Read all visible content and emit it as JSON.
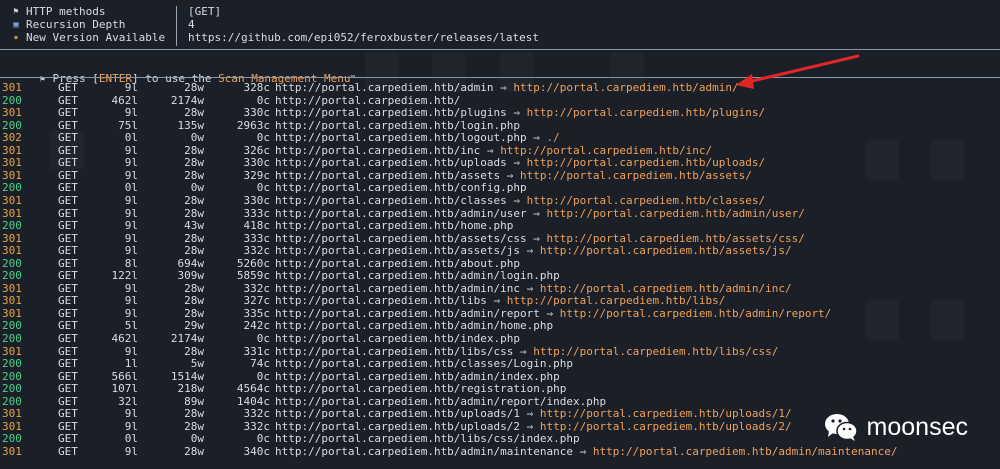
{
  "header": {
    "rows": [
      {
        "icon": "flag-icon",
        "glyph": "⚑",
        "key": "HTTP methods",
        "value": "[GET]"
      },
      {
        "icon": "disk-icon",
        "glyph": "▣",
        "key": "Recursion Depth",
        "value": "4"
      },
      {
        "icon": "party-icon",
        "glyph": "✷",
        "key": "New Version Available",
        "value": "https://github.com/epi052/feroxbuster/releases/latest"
      }
    ],
    "press_pre": "Press [",
    "press_key": "ENTER",
    "press_mid": "] to use the ",
    "press_menu": "Scan Management Menu",
    "press_tm": "™"
  },
  "colors": {
    "redirect": "#f0a15a",
    "ok": "#4cd18a",
    "arrow": "#e02626"
  },
  "results": [
    {
      "status": "301",
      "method": "GET",
      "lines": "9l",
      "words": "28w",
      "chars": "328c",
      "url": "http://portal.carpediem.htb/admin",
      "redirect": "http://portal.carpediem.htb/admin/"
    },
    {
      "status": "200",
      "method": "GET",
      "lines": "462l",
      "words": "2174w",
      "chars": "0c",
      "url": "http://portal.carpediem.htb/",
      "redirect": ""
    },
    {
      "status": "301",
      "method": "GET",
      "lines": "9l",
      "words": "28w",
      "chars": "330c",
      "url": "http://portal.carpediem.htb/plugins",
      "redirect": "http://portal.carpediem.htb/plugins/"
    },
    {
      "status": "200",
      "method": "GET",
      "lines": "75l",
      "words": "135w",
      "chars": "2963c",
      "url": "http://portal.carpediem.htb/login.php",
      "redirect": ""
    },
    {
      "status": "302",
      "method": "GET",
      "lines": "0l",
      "words": "0w",
      "chars": "0c",
      "url": "http://portal.carpediem.htb/logout.php",
      "redirect": "./"
    },
    {
      "status": "301",
      "method": "GET",
      "lines": "9l",
      "words": "28w",
      "chars": "326c",
      "url": "http://portal.carpediem.htb/inc",
      "redirect": "http://portal.carpediem.htb/inc/"
    },
    {
      "status": "301",
      "method": "GET",
      "lines": "9l",
      "words": "28w",
      "chars": "330c",
      "url": "http://portal.carpediem.htb/uploads",
      "redirect": "http://portal.carpediem.htb/uploads/"
    },
    {
      "status": "301",
      "method": "GET",
      "lines": "9l",
      "words": "28w",
      "chars": "329c",
      "url": "http://portal.carpediem.htb/assets",
      "redirect": "http://portal.carpediem.htb/assets/"
    },
    {
      "status": "200",
      "method": "GET",
      "lines": "0l",
      "words": "0w",
      "chars": "0c",
      "url": "http://portal.carpediem.htb/config.php",
      "redirect": ""
    },
    {
      "status": "301",
      "method": "GET",
      "lines": "9l",
      "words": "28w",
      "chars": "330c",
      "url": "http://portal.carpediem.htb/classes",
      "redirect": "http://portal.carpediem.htb/classes/"
    },
    {
      "status": "301",
      "method": "GET",
      "lines": "9l",
      "words": "28w",
      "chars": "333c",
      "url": "http://portal.carpediem.htb/admin/user",
      "redirect": "http://portal.carpediem.htb/admin/user/"
    },
    {
      "status": "200",
      "method": "GET",
      "lines": "9l",
      "words": "43w",
      "chars": "418c",
      "url": "http://portal.carpediem.htb/home.php",
      "redirect": ""
    },
    {
      "status": "301",
      "method": "GET",
      "lines": "9l",
      "words": "28w",
      "chars": "333c",
      "url": "http://portal.carpediem.htb/assets/css",
      "redirect": "http://portal.carpediem.htb/assets/css/"
    },
    {
      "status": "301",
      "method": "GET",
      "lines": "9l",
      "words": "28w",
      "chars": "332c",
      "url": "http://portal.carpediem.htb/assets/js",
      "redirect": "http://portal.carpediem.htb/assets/js/"
    },
    {
      "status": "200",
      "method": "GET",
      "lines": "8l",
      "words": "694w",
      "chars": "5260c",
      "url": "http://portal.carpediem.htb/about.php",
      "redirect": ""
    },
    {
      "status": "200",
      "method": "GET",
      "lines": "122l",
      "words": "309w",
      "chars": "5859c",
      "url": "http://portal.carpediem.htb/admin/login.php",
      "redirect": ""
    },
    {
      "status": "301",
      "method": "GET",
      "lines": "9l",
      "words": "28w",
      "chars": "332c",
      "url": "http://portal.carpediem.htb/admin/inc",
      "redirect": "http://portal.carpediem.htb/admin/inc/"
    },
    {
      "status": "301",
      "method": "GET",
      "lines": "9l",
      "words": "28w",
      "chars": "327c",
      "url": "http://portal.carpediem.htb/libs",
      "redirect": "http://portal.carpediem.htb/libs/"
    },
    {
      "status": "301",
      "method": "GET",
      "lines": "9l",
      "words": "28w",
      "chars": "335c",
      "url": "http://portal.carpediem.htb/admin/report",
      "redirect": "http://portal.carpediem.htb/admin/report/"
    },
    {
      "status": "200",
      "method": "GET",
      "lines": "5l",
      "words": "29w",
      "chars": "242c",
      "url": "http://portal.carpediem.htb/admin/home.php",
      "redirect": ""
    },
    {
      "status": "200",
      "method": "GET",
      "lines": "462l",
      "words": "2174w",
      "chars": "0c",
      "url": "http://portal.carpediem.htb/index.php",
      "redirect": ""
    },
    {
      "status": "301",
      "method": "GET",
      "lines": "9l",
      "words": "28w",
      "chars": "331c",
      "url": "http://portal.carpediem.htb/libs/css",
      "redirect": "http://portal.carpediem.htb/libs/css/"
    },
    {
      "status": "200",
      "method": "GET",
      "lines": "1l",
      "words": "5w",
      "chars": "74c",
      "url": "http://portal.carpediem.htb/classes/Login.php",
      "redirect": ""
    },
    {
      "status": "200",
      "method": "GET",
      "lines": "566l",
      "words": "1514w",
      "chars": "0c",
      "url": "http://portal.carpediem.htb/admin/index.php",
      "redirect": ""
    },
    {
      "status": "200",
      "method": "GET",
      "lines": "107l",
      "words": "218w",
      "chars": "4564c",
      "url": "http://portal.carpediem.htb/registration.php",
      "redirect": ""
    },
    {
      "status": "200",
      "method": "GET",
      "lines": "32l",
      "words": "89w",
      "chars": "1404c",
      "url": "http://portal.carpediem.htb/admin/report/index.php",
      "redirect": ""
    },
    {
      "status": "301",
      "method": "GET",
      "lines": "9l",
      "words": "28w",
      "chars": "332c",
      "url": "http://portal.carpediem.htb/uploads/1",
      "redirect": "http://portal.carpediem.htb/uploads/1/"
    },
    {
      "status": "301",
      "method": "GET",
      "lines": "9l",
      "words": "28w",
      "chars": "332c",
      "url": "http://portal.carpediem.htb/uploads/2",
      "redirect": "http://portal.carpediem.htb/uploads/2/"
    },
    {
      "status": "200",
      "method": "GET",
      "lines": "0l",
      "words": "0w",
      "chars": "0c",
      "url": "http://portal.carpediem.htb/libs/css/index.php",
      "redirect": ""
    },
    {
      "status": "301",
      "method": "GET",
      "lines": "9l",
      "words": "28w",
      "chars": "340c",
      "url": "http://portal.carpediem.htb/admin/maintenance",
      "redirect": "http://portal.carpediem.htb/admin/maintenance/"
    }
  ],
  "arrow_glyph": "⇒",
  "watermark": {
    "text": "moonsec",
    "icon": "wechat-icon"
  }
}
